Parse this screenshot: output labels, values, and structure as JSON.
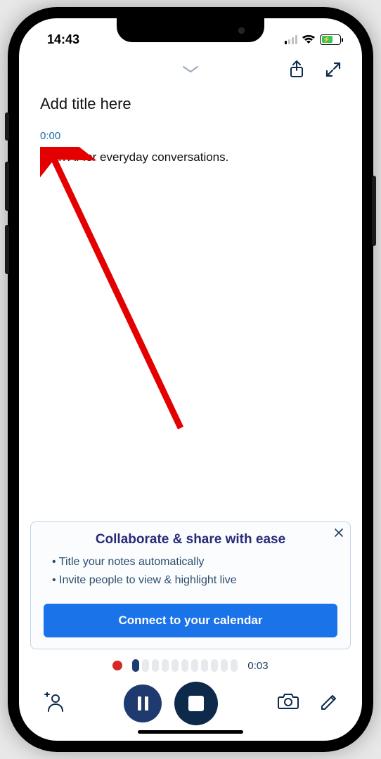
{
  "statusbar": {
    "time": "14:43"
  },
  "header": {
    "title_placeholder": "Add title here"
  },
  "transcript": {
    "timestamp": "0:00",
    "text": "is an AI for everyday conversations."
  },
  "promo": {
    "title": "Collaborate & share with ease",
    "items": [
      "Title your notes automatically",
      "Invite people to view & highlight live"
    ],
    "cta": "Connect to your calendar"
  },
  "playback": {
    "elapsed": "0:03"
  }
}
